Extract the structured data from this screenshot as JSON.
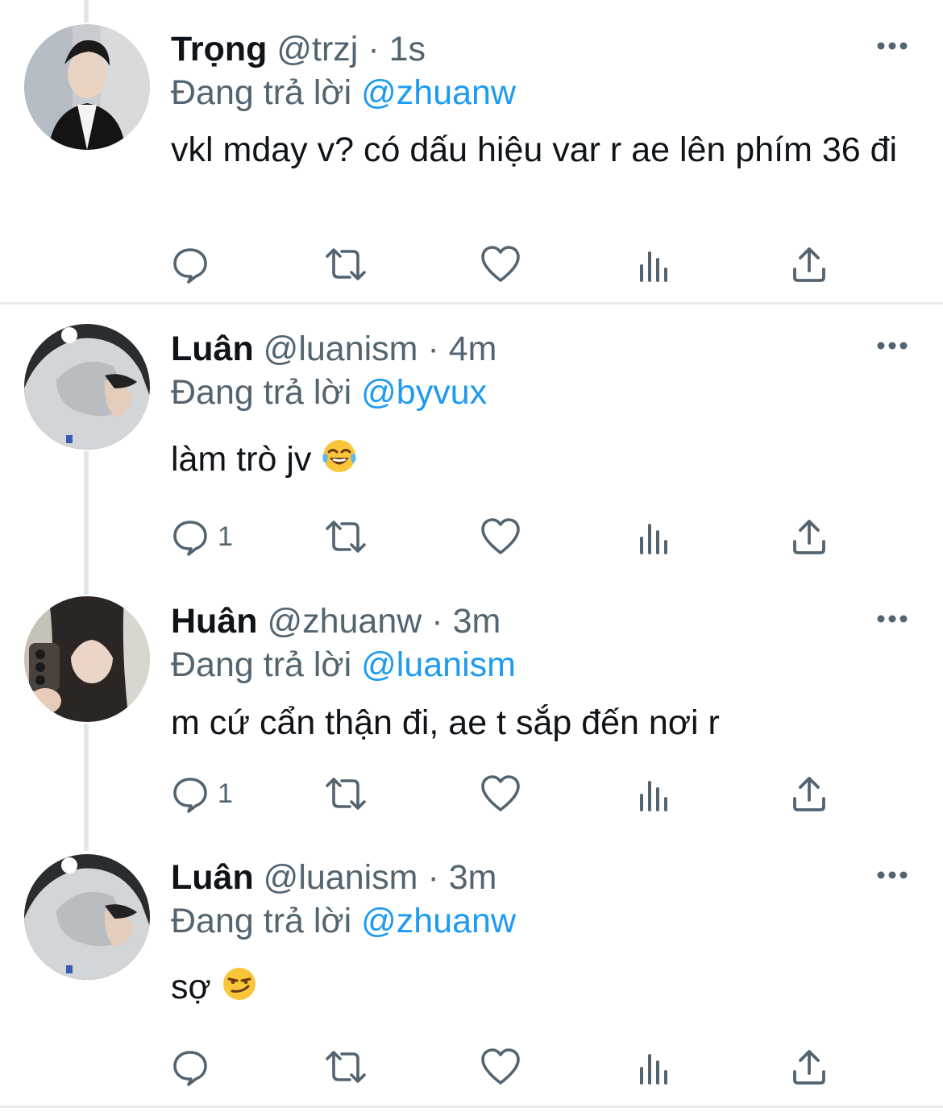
{
  "tweets": [
    {
      "name": "Trọng",
      "handle": "@trzj",
      "separator": "·",
      "time": "1s",
      "reply_prefix": "Đang trả lời",
      "reply_to": "@zhuanw",
      "text": "vkl mday v? có dấu hiệu var r ae lên phím 36 đi",
      "reply_count": "",
      "avatar_icon": "avatar-photo-man-in-black-jacket"
    },
    {
      "name": "Luân",
      "handle": "@luanism",
      "separator": "·",
      "time": "4m",
      "reply_prefix": "Đang trả lời",
      "reply_to": "@byvux",
      "text": "làm trò jv",
      "emoji": "face-with-tears-of-joy",
      "reply_count": "1",
      "avatar_icon": "avatar-photo-grey-hoodie"
    },
    {
      "name": "Huân",
      "handle": "@zhuanw",
      "separator": "·",
      "time": "3m",
      "reply_prefix": "Đang trả lời",
      "reply_to": "@luanism",
      "text": "m cứ cẩn thận đi, ae t sắp đến nơi r",
      "reply_count": "1",
      "avatar_icon": "avatar-photo-mirror-selfie"
    },
    {
      "name": "Luân",
      "handle": "@luanism",
      "separator": "·",
      "time": "3m",
      "reply_prefix": "Đang trả lời",
      "reply_to": "@zhuanw",
      "text": "sợ",
      "emoji": "smirking-face",
      "reply_count": "",
      "avatar_icon": "avatar-photo-grey-hoodie"
    }
  ],
  "icons": {
    "reply": "reply-icon",
    "retweet": "retweet-icon",
    "like": "heart-icon",
    "views": "views-chart-icon",
    "share": "share-icon",
    "more": "more-dots-icon"
  },
  "colors": {
    "text": "#0f1419",
    "secondary": "#536471",
    "accent": "#1d9bf0",
    "divider": "#e6ecf0"
  }
}
